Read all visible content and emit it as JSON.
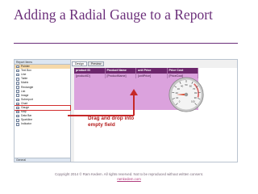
{
  "slide": {
    "title": "Adding a Radial Gauge to a Report",
    "callout": "Drag and drop into empty field",
    "footer": "Copyright 2014 © Ram Kedem. All rights reserved. Not to be reproduced without written consent.",
    "footer_link": "ramkedem.com"
  },
  "ide": {
    "panel_header": "Report Items",
    "panel_footer": "General",
    "items": [
      {
        "label": "Pointer",
        "selected": true
      },
      {
        "label": "Text Box"
      },
      {
        "label": "Line"
      },
      {
        "label": "Table"
      },
      {
        "label": "Matrix"
      },
      {
        "label": "Rectangle"
      },
      {
        "label": "List"
      },
      {
        "label": "Image"
      },
      {
        "label": "Subreport"
      },
      {
        "label": "Chart"
      },
      {
        "label": "Gauge",
        "highlight": true
      },
      {
        "label": "Map"
      },
      {
        "label": "Data Bar"
      },
      {
        "label": "Sparkline"
      },
      {
        "label": "Indicator"
      }
    ],
    "tabs": [
      "Design",
      "Preview"
    ],
    "table": {
      "headers": [
        "product ID",
        "Product Name",
        "unit Price",
        "Price Cost"
      ],
      "cells": [
        "[productID]",
        "[ProductName]",
        "[unitPrice]",
        "[PriceCost]"
      ]
    },
    "gauge_scale": [
      "0",
      "10",
      "20",
      "30",
      "40",
      "50",
      "60",
      "70",
      "80",
      "90",
      "100"
    ]
  }
}
